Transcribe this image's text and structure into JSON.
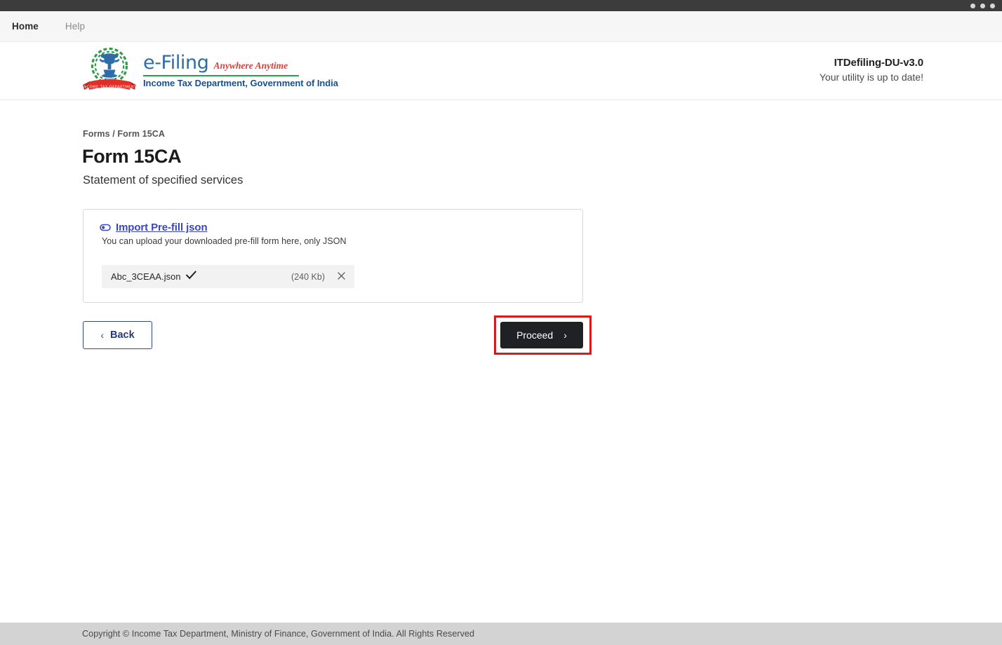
{
  "window": {
    "dots": [
      "dot-1",
      "dot-2",
      "dot-3"
    ]
  },
  "menubar": {
    "items": [
      {
        "label": "Home",
        "state": "active"
      },
      {
        "label": "Help",
        "state": "muted"
      }
    ]
  },
  "header": {
    "emblem_alt": "india-emblem-income-tax-department",
    "brand_title": "e-Filing",
    "brand_tagline": "Anywhere Anytime",
    "brand_subtitle": "Income Tax Department, Government of India",
    "version": "ITDefiling-DU-v3.0",
    "version_status": "Your utility is up to date!",
    "colors": {
      "brand_blue": "#2e6ca4",
      "tagline_red": "#d6403e",
      "rule_green": "#2e9c4a",
      "subtitle_blue": "#1a4f8a"
    }
  },
  "main": {
    "breadcrumb": "Forms / Form 15CA",
    "title": "Form 15CA",
    "subtitle": "Statement of specified services",
    "upload_card": {
      "clip_icon": "paperclip-icon",
      "link_label": "Import Pre-fill json",
      "hint": "You can upload your downloaded pre-fill form here, only JSON",
      "file": {
        "name": "Abc_3CEAA.json",
        "status_icon": "check-icon",
        "size": "(240 Kb)",
        "remove_icon": "close-icon"
      }
    },
    "actions": {
      "back_label": "Back",
      "back_icon": "chevron-left-icon",
      "proceed_label": "Proceed",
      "proceed_icon": "chevron-right-icon",
      "highlight_color": "#d51b1b"
    }
  },
  "footer": {
    "copyright": "Copyright © Income Tax Department, Ministry of Finance, Government of India. All Rights Reserved"
  }
}
